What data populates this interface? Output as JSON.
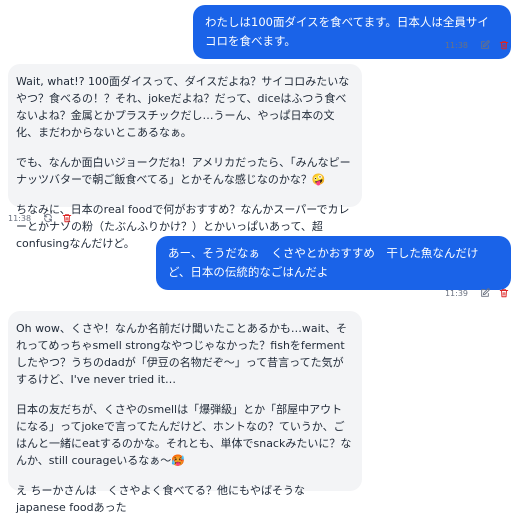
{
  "messages": [
    {
      "role": "user",
      "text": "わたしは100面ダイスを食べてます。日本人は全員サイコロを食べます。",
      "time": "11:38",
      "icons": [
        "edit-icon",
        "trash-icon"
      ]
    },
    {
      "role": "assistant",
      "paragraphs": [
        "Wait, what!? 100面ダイスって、ダイスだよね？サイコロみたいなやつ？食べるの！？それ、jokeだよね？だって、diceはふつう食べないよね？金属とかプラスチックだし…うーん、やっぱ日本の文化、まだわからないとこあるなぁ。",
        "でも、なんか面白いジョークだね！アメリカだったら、「みんなピーナッツバターで朝ご飯食べてる」とかそんな感じなのかな？🤪",
        "ちなみに、日本のreal foodで何がおすすめ？なんかスーパーでカレーとかナゾの粉（たぶんふりかけ？）とかいっぱいあって、超confusingなんだけど。"
      ],
      "time": "11:38",
      "icons": [
        "refresh-icon",
        "trash-icon"
      ]
    },
    {
      "role": "user",
      "text": "あー、そうだなぁ　くさやとかおすすめ　干した魚なんだけど、日本の伝統的なごはんだよ",
      "time": "11:39",
      "icons": [
        "edit-icon",
        "trash-icon"
      ]
    },
    {
      "role": "assistant",
      "paragraphs": [
        "Oh wow、くさや！なんか名前だけ聞いたことあるかも…wait、それってめっちゃsmell strongなやつじゃなかった？fishをfermentしたやつ？うちのdadが「伊豆の名物だぞ〜」って昔言ってた気がするけど、I've never tried it…",
        "日本の友だちが、くさやのsmellは「爆弾級」とか「部屋中アウトになる」ってjokeで言ってたんだけど、ホントなの？ていうか、ごはんと一緒にeatするのかな。それとも、単体でsnackみたいに？なんか、still courageいるなぁ〜🥵",
        "え ちーかさんは　くさやよく食べてる？他にもやばそうなjapanese foodあった"
      ]
    }
  ],
  "colors": {
    "user_bubble": "#1a63e8",
    "assistant_bubble": "#f3f4f6",
    "trash": "#dc2626",
    "icon_gray": "#6b7280"
  }
}
